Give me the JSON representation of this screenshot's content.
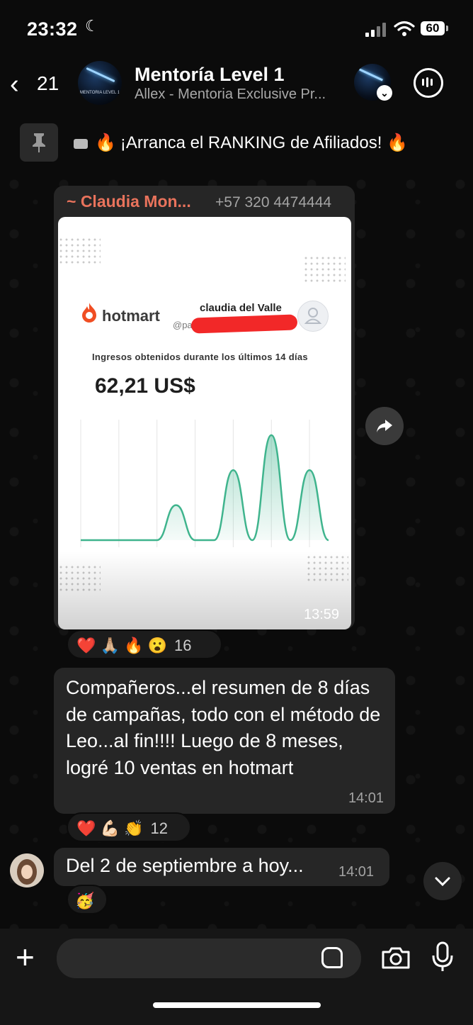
{
  "status_bar": {
    "time": "23:32",
    "battery": "60"
  },
  "header": {
    "back_count": "21",
    "title": "Mentoría Level 1",
    "subtitle": "Allex - Mentoria Exclusive Pr...",
    "avatar_label": "MENTORIA LEVEL 1"
  },
  "pinned": {
    "text": "¡Arranca el RANKING de Afiliados! 🔥",
    "icons": [
      "video-icon",
      "fire-emoji"
    ]
  },
  "message_image": {
    "sender": "~ Claudia Mon...",
    "phone": "+57 320 4474444",
    "time": "13:59",
    "reactions": "❤️ 🙏🏼 🔥 😮",
    "reaction_count": "16",
    "screenshot": {
      "brand": "hotmart",
      "user_name": "claudia del Valle",
      "handle": "@pa",
      "caption": "Ingresos obtenidos durante los últimos 14 días",
      "amount": "62,21 US$"
    }
  },
  "chart_data": {
    "type": "area",
    "title": "",
    "xlabel": "",
    "ylabel": "",
    "x": [
      1,
      2,
      3,
      4,
      5,
      6,
      7,
      8,
      9,
      10,
      11,
      12,
      13,
      14
    ],
    "series": [
      {
        "values": [
          0,
          0,
          0,
          0,
          0,
          1,
          0,
          0,
          2,
          0,
          3,
          0,
          2,
          0
        ]
      }
    ],
    "ylim": [
      0,
      3.2
    ],
    "grid": true,
    "accent_color": "#3fb48d"
  },
  "message_text": {
    "text": "Compañeros...el resumen de 8 días de campañas, todo con el método de Leo...al fin!!!! Luego de 8 meses, logré 10 ventas en hotmart",
    "time": "14:01",
    "reactions": "❤️ 💪🏻 👏",
    "reaction_count": "12"
  },
  "message_small": {
    "text": "Del 2 de septiembre a hoy...",
    "time": "14:01",
    "reactions": "🥳"
  },
  "composer": {
    "placeholder": ""
  }
}
